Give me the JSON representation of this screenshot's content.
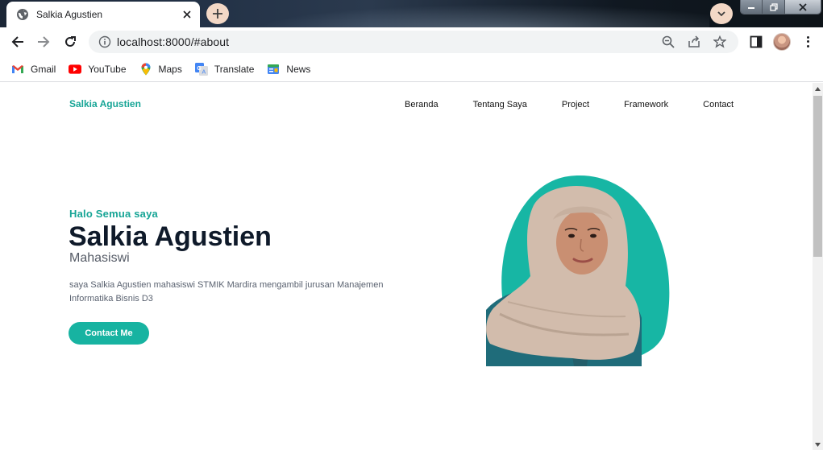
{
  "browser": {
    "tab": {
      "title": "Salkia Agustien",
      "favicon": "globe-icon"
    },
    "address_bar": {
      "url": "localhost:8000/#about"
    },
    "bookmarks": [
      {
        "label": "Gmail",
        "icon": "gmail-icon"
      },
      {
        "label": "YouTube",
        "icon": "youtube-icon"
      },
      {
        "label": "Maps",
        "icon": "maps-icon"
      },
      {
        "label": "Translate",
        "icon": "translate-icon"
      },
      {
        "label": "News",
        "icon": "news-icon"
      }
    ]
  },
  "site": {
    "logo": "Salkia Agustien",
    "nav": [
      "Beranda",
      "Tentang Saya",
      "Project",
      "Framework",
      "Contact"
    ],
    "hero": {
      "greeting": "Halo Semua saya",
      "name": "Salkia Agustien",
      "role": "Mahasiswi",
      "description": "saya Salkia Agustien mahasiswi STMIK Mardira mengambil jurusan Manajemen Informatika Bisnis D3",
      "cta": "Contact Me"
    },
    "colors": {
      "accent": "#17b3a1",
      "heading": "#0f1a2a",
      "blob": "#17b6a4"
    }
  }
}
